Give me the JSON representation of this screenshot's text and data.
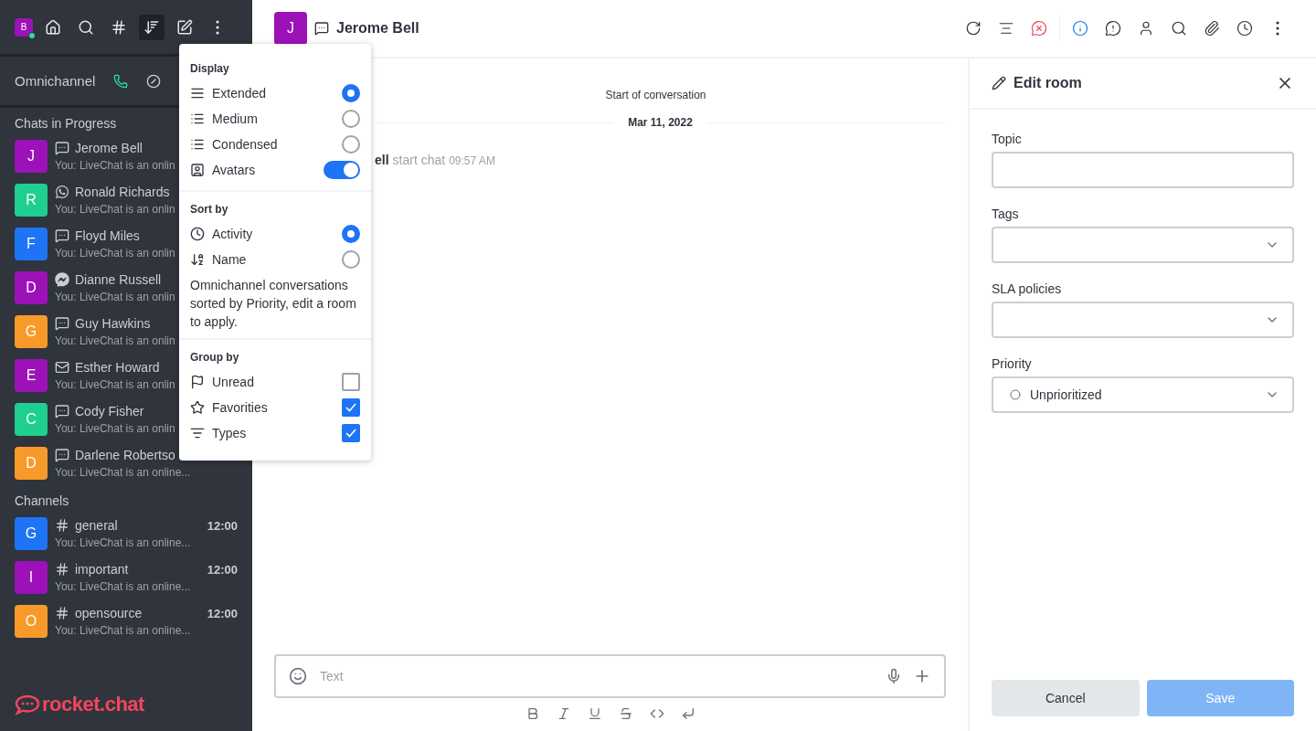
{
  "sidebar": {
    "user_avatar": {
      "initial": "B",
      "color": "#9c12b8"
    },
    "nav": [
      {
        "kind": "home",
        "selected": false
      },
      {
        "kind": "search",
        "selected": false
      },
      {
        "kind": "directory",
        "selected": false
      },
      {
        "kind": "sort",
        "selected": true
      },
      {
        "kind": "write",
        "selected": false
      },
      {
        "kind": "more",
        "selected": false
      }
    ],
    "omnichannel": {
      "label": "Omnichannel"
    },
    "sections": [
      {
        "title": "Chats in Progress",
        "items": [
          {
            "initial": "J",
            "color": "#9c12b8",
            "kind": "livechat",
            "name": "Jerome Bell",
            "preview": "You: LiveChat is an onlin"
          },
          {
            "initial": "R",
            "color": "#1ecf8f",
            "kind": "whatsapp",
            "name": "Ronald Richards",
            "preview": "You: LiveChat is an onlin"
          },
          {
            "initial": "F",
            "color": "#1d74f5",
            "kind": "livechat",
            "name": "Floyd Miles",
            "preview": "You: LiveChat is an onlin"
          },
          {
            "initial": "D",
            "color": "#9c12b8",
            "kind": "messenger",
            "name": "Dianne Russell",
            "preview": "You: LiveChat is an onlin"
          },
          {
            "initial": "G",
            "color": "#f79a2a",
            "kind": "livechat",
            "name": "Guy Hawkins",
            "preview": "You: LiveChat is an onlin"
          },
          {
            "initial": "E",
            "color": "#9c12b8",
            "kind": "email",
            "name": "Esther Howard",
            "preview": "You: LiveChat is an onlin"
          },
          {
            "initial": "C",
            "color": "#1ecf8f",
            "kind": "livechat",
            "name": "Cody Fisher",
            "preview": "You: LiveChat is an onlin"
          },
          {
            "initial": "D",
            "color": "#f79a2a",
            "kind": "livechat",
            "name": "Darlene Robertso",
            "preview": "You: LiveChat is an online..."
          }
        ]
      },
      {
        "title": "Channels",
        "items": [
          {
            "initial": "G",
            "color": "#1d74f5",
            "kind": "channel",
            "name": "general",
            "time": "12:00",
            "preview": "You: LiveChat is an online..."
          },
          {
            "initial": "I",
            "color": "#9c12b8",
            "kind": "channel",
            "name": "important",
            "time": "12:00",
            "preview": "You: LiveChat is an online..."
          },
          {
            "initial": "O",
            "color": "#f79a2a",
            "kind": "channel",
            "name": "opensource",
            "time": "12:00",
            "preview": "You: LiveChat is an online..."
          }
        ]
      }
    ],
    "logo": "rocket.chat"
  },
  "display_menu": {
    "sections": [
      {
        "title": "Display",
        "items": [
          {
            "kind": "radio",
            "label": "Extended",
            "selected": true
          },
          {
            "kind": "radio",
            "label": "Medium",
            "selected": false
          },
          {
            "kind": "radio",
            "label": "Condensed",
            "selected": false
          },
          {
            "kind": "toggle",
            "label": "Avatars",
            "on": true
          }
        ]
      },
      {
        "title": "Sort by",
        "items": [
          {
            "kind": "radio",
            "label": "Activity",
            "selected": true
          },
          {
            "kind": "radio",
            "label": "Name",
            "selected": false
          }
        ],
        "note": "Omnichannel conversations sorted by Priority, edit a room to apply."
      },
      {
        "title": "Group by",
        "items": [
          {
            "kind": "checkbox",
            "label": "Unread",
            "checked": false
          },
          {
            "kind": "checkbox",
            "label": "Favorities",
            "checked": true
          },
          {
            "kind": "checkbox",
            "label": "Types",
            "checked": true
          }
        ]
      }
    ]
  },
  "room": {
    "avatar": {
      "initial": "J",
      "color": "#9c12b8"
    },
    "title": "Jerome Bell",
    "toolbar": [
      {
        "kind": "forward",
        "selected": false
      },
      {
        "kind": "transcript",
        "selected": false
      },
      {
        "kind": "close",
        "selected": false
      },
      {
        "kind": "info",
        "selected": true
      },
      {
        "kind": "alert",
        "selected": false
      },
      {
        "kind": "contact",
        "selected": false
      },
      {
        "kind": "search",
        "selected": false
      },
      {
        "kind": "files",
        "selected": false
      },
      {
        "kind": "history",
        "selected": false
      },
      {
        "kind": "more",
        "selected": false
      }
    ],
    "start": "Start of conversation",
    "date": "Mar 11, 2022",
    "message": {
      "author": "ell",
      "text": "start chat",
      "time": "09:57 AM"
    },
    "composer": {
      "placeholder": "Text"
    }
  },
  "edit_panel": {
    "title": "Edit room",
    "fields": [
      {
        "kind": "text",
        "label": "Topic"
      },
      {
        "kind": "select",
        "label": "Tags"
      },
      {
        "kind": "select",
        "label": "SLA policies"
      },
      {
        "kind": "select",
        "label": "Priority",
        "value": "Unprioritized"
      }
    ],
    "buttons": [
      {
        "label": "Cancel",
        "primary": false
      },
      {
        "label": "Save",
        "primary": true,
        "disabled": true
      }
    ]
  }
}
